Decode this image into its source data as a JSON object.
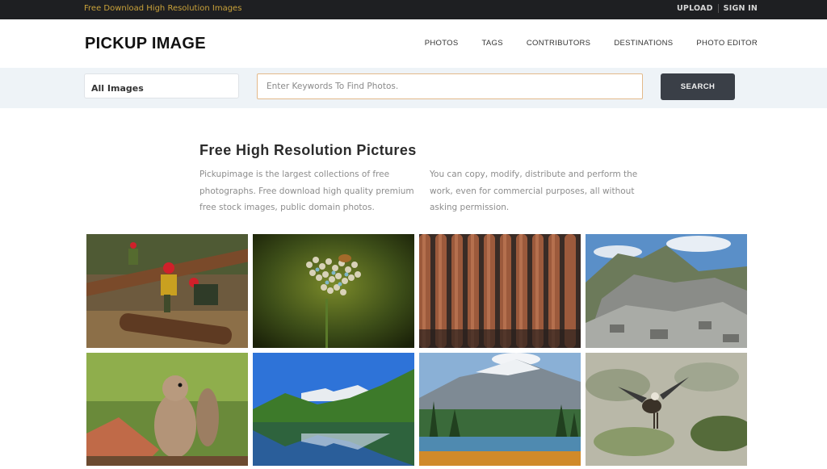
{
  "topbar": {
    "tagline": "Free Download High Resolution Images",
    "upload": "UPLOAD",
    "signin": "SIGN IN"
  },
  "header": {
    "logo": "PICKUP IMAGE",
    "nav": [
      "PHOTOS",
      "TAGS",
      "CONTRIBUTORS",
      "DESTINATIONS",
      "PHOTO EDITOR"
    ]
  },
  "search": {
    "category": "All Images",
    "placeholder": "Enter Keywords To Find Photos.",
    "button": "SEARCH"
  },
  "intro": {
    "title": "Free High Resolution Pictures",
    "left": "Pickupimage is the largest collections of free photographs. Free download high quality premium free stock images, public domain photos.",
    "right": "You can copy, modify, distribute and perform the work, even for commercial purposes, all without asking permission."
  },
  "photos": [
    {
      "subject": "firefighters-logs"
    },
    {
      "subject": "yarrow-flower-bee"
    },
    {
      "subject": "ammunition-bullets"
    },
    {
      "subject": "rocky-mountain"
    },
    {
      "subject": "squirrel"
    },
    {
      "subject": "mountain-lake-reflection"
    },
    {
      "subject": "glacier-valley-lake"
    },
    {
      "subject": "bird-lily-pads"
    }
  ],
  "colors": {
    "topbar_bg": "#1e1f22",
    "tagline": "#c9a23a",
    "search_band": "#eef3f7",
    "search_button": "#3a3f47",
    "input_border": "#e3b98a"
  }
}
